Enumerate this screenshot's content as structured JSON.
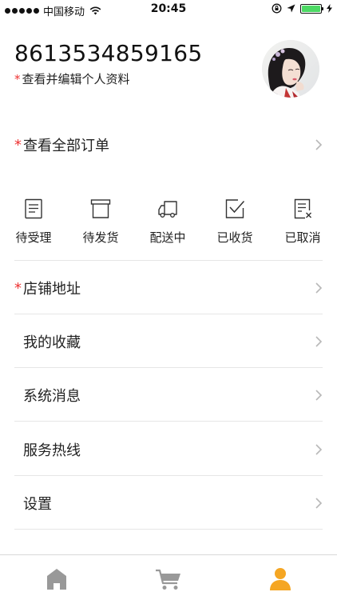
{
  "status_bar": {
    "carrier": "中国移动",
    "time": "20:45",
    "battery_level": 1.0
  },
  "profile": {
    "phone": "8613534859165",
    "edit_link": "查看并编辑个人资料",
    "required_mark": "*"
  },
  "orders": {
    "all_orders_label": "查看全部订单",
    "statuses": [
      {
        "label": "待受理",
        "icon": "document-list-icon"
      },
      {
        "label": "待发货",
        "icon": "box-icon"
      },
      {
        "label": "配送中",
        "icon": "delivery-truck-icon"
      },
      {
        "label": "已收货",
        "icon": "checked-box-icon"
      },
      {
        "label": "已取消",
        "icon": "cancelled-document-icon"
      }
    ]
  },
  "menu": [
    {
      "label": "店铺地址",
      "required": true
    },
    {
      "label": "我的收藏",
      "required": false
    },
    {
      "label": "系统消息",
      "required": false
    },
    {
      "label": "服务热线",
      "required": false
    },
    {
      "label": "设置",
      "required": false
    }
  ],
  "tab_bar": {
    "tabs": [
      {
        "icon": "home-icon",
        "active": false
      },
      {
        "icon": "cart-icon",
        "active": false
      },
      {
        "icon": "user-icon",
        "active": true
      }
    ],
    "inactive_color": "#999999",
    "active_color": "#f5a623"
  },
  "colors": {
    "required_mark": "#e33333",
    "battery": "#4cd964"
  }
}
